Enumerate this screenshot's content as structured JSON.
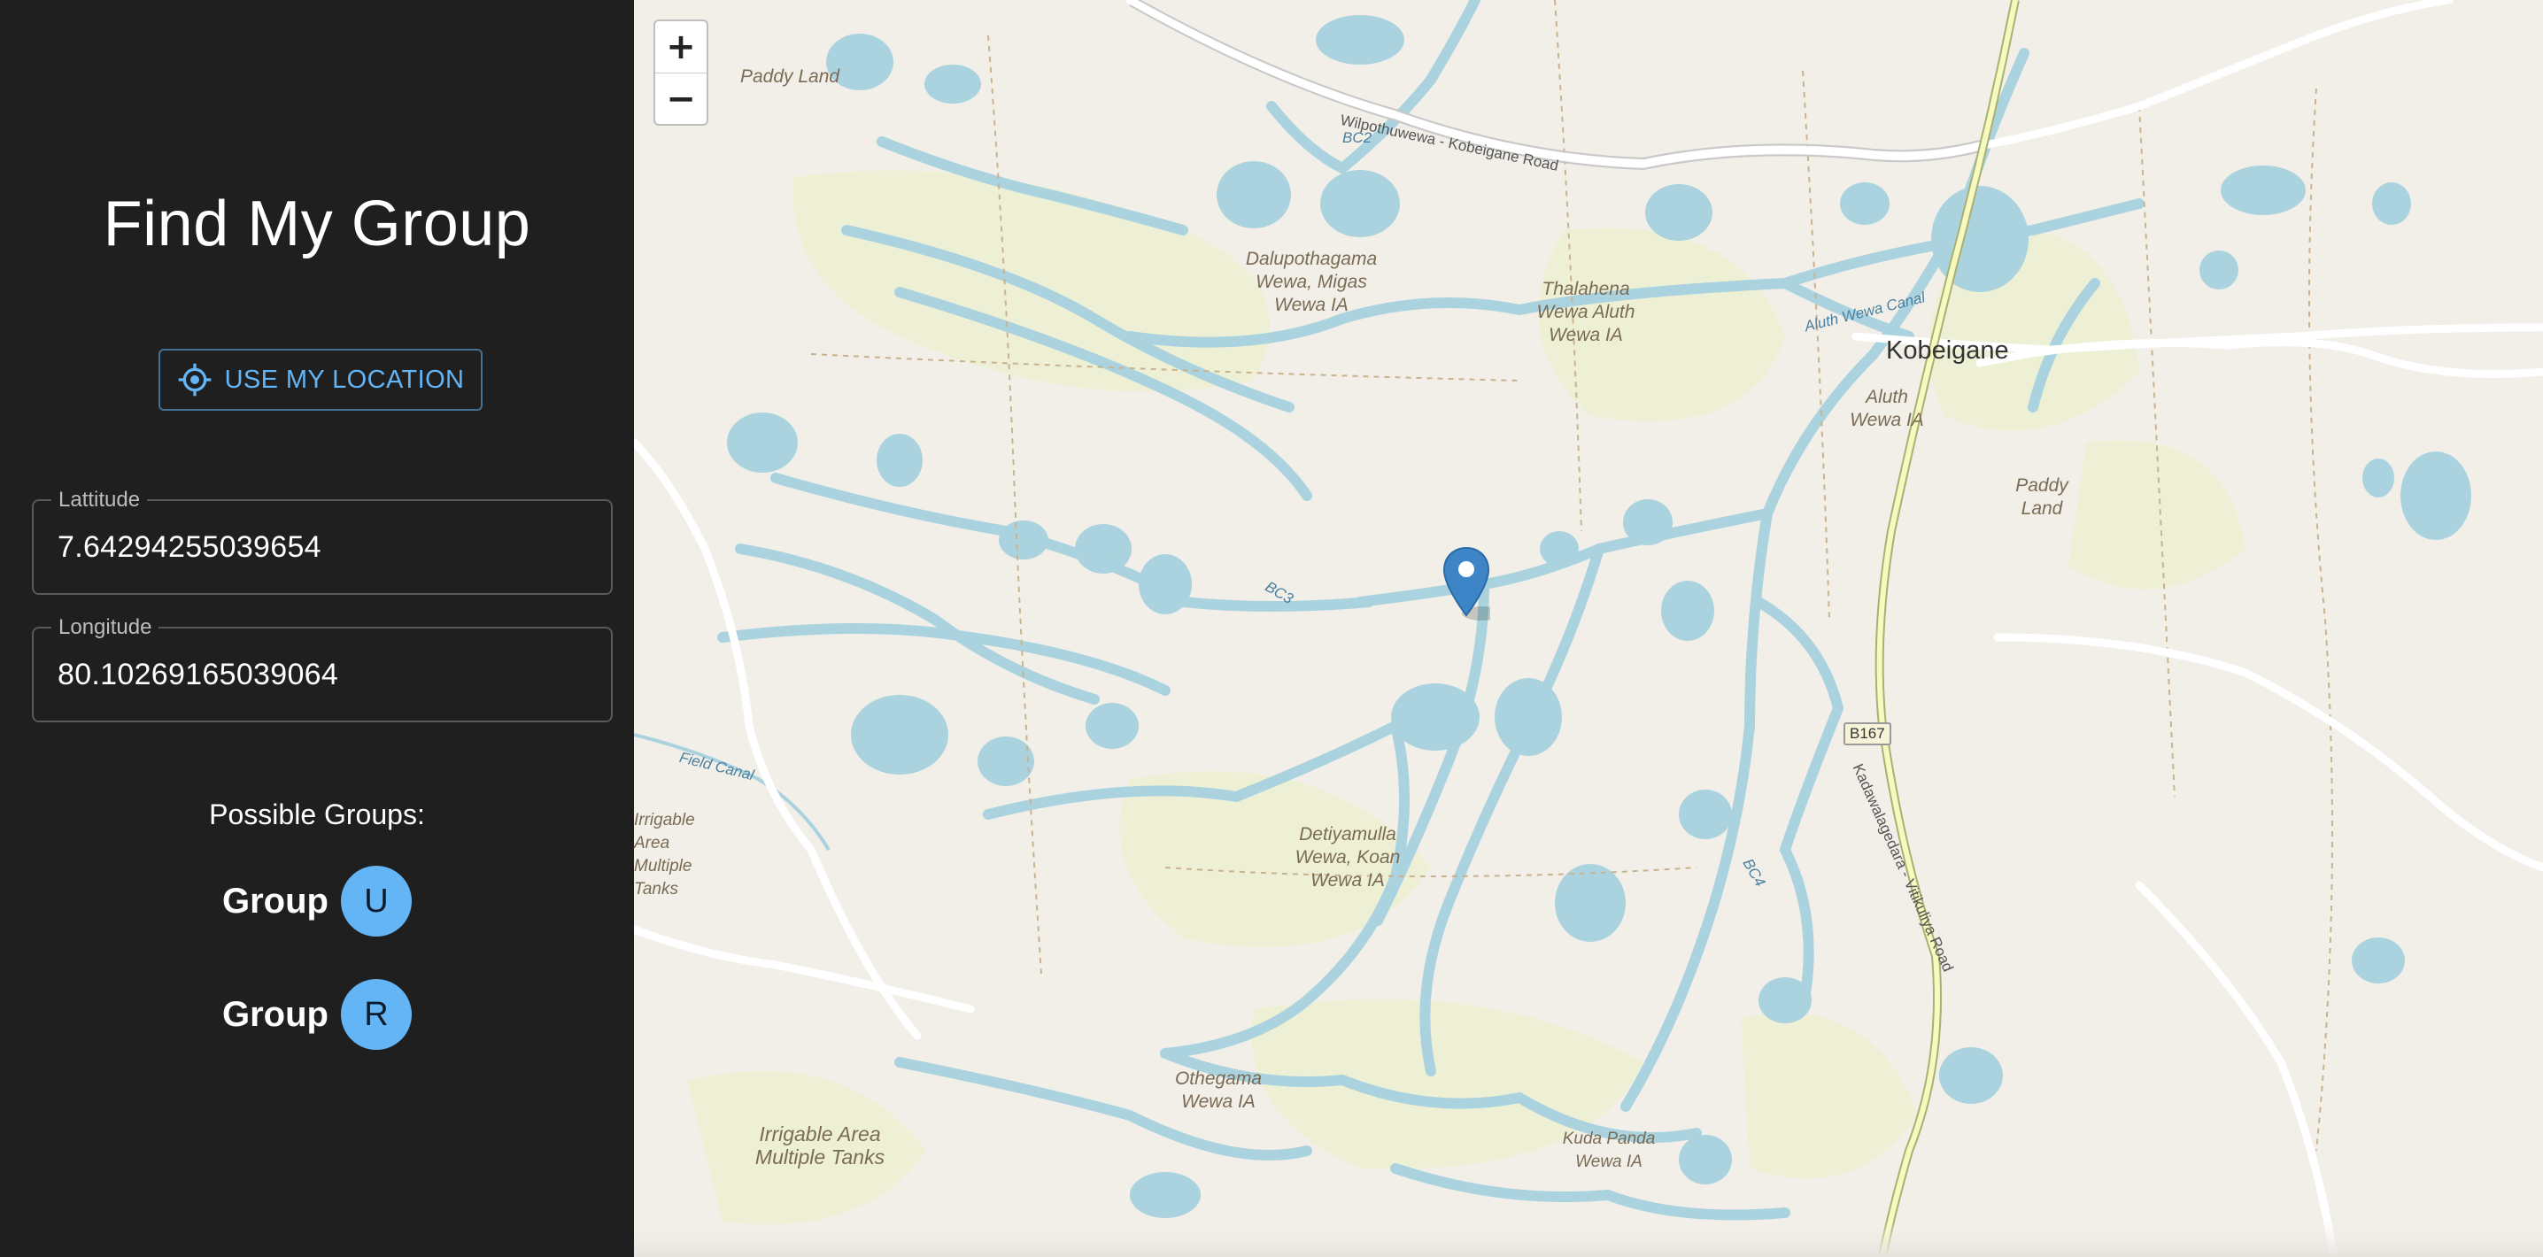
{
  "sidebar": {
    "title": "Find My Group",
    "location_button": "USE MY LOCATION",
    "latitude": {
      "label": "Lattitude",
      "value": "7.64294255039654"
    },
    "longitude": {
      "label": "Longitude",
      "value": "80.10269165039064"
    },
    "groups_label": "Possible Groups:",
    "groups": [
      {
        "text": "Group",
        "badge": "U"
      },
      {
        "text": "Group",
        "badge": "R"
      }
    ]
  },
  "map": {
    "zoom_in": "+",
    "zoom_out": "−",
    "marker_icon": "map-pin-icon",
    "labels": {
      "paddy_land_1": "Paddy Land",
      "paddy_land_2": "Paddy Land",
      "dalupothagama": "Dalupothagama Wewa, Migas Wewa IA",
      "thalahena": "Thalahena Wewa Aluth Wewa IA",
      "aluth_wewa": "Aluth Wewa IA",
      "detiyamulla": "Detiyamulla Wewa, Koan Wewa IA",
      "othegama": "Othegama Wewa IA",
      "irrigable_1": "Irrigable Area Multiple Tanks",
      "irrigable_2": "Irrigable Area Multiple Tanks",
      "kuda_panda": "Kuda Panda Wewa IA"
    },
    "town": "Kobeigane",
    "roads": {
      "wilpothuwewa": "Wilpothuwewa - Kobeigane Road",
      "kadawalagedara": "Kadawalagedara - Vitikuliya Road",
      "aluth_canal": "Aluth Wewa Canal",
      "field_canal": "Field Canal",
      "bc2": "BC2",
      "bc3": "BC3",
      "bc4": "BC4"
    },
    "route_shield": "B167",
    "colors": {
      "land": "#f2efe9",
      "water": "#aad3df",
      "farmland": "#eef0d5",
      "accent": "#64b5f6"
    }
  }
}
